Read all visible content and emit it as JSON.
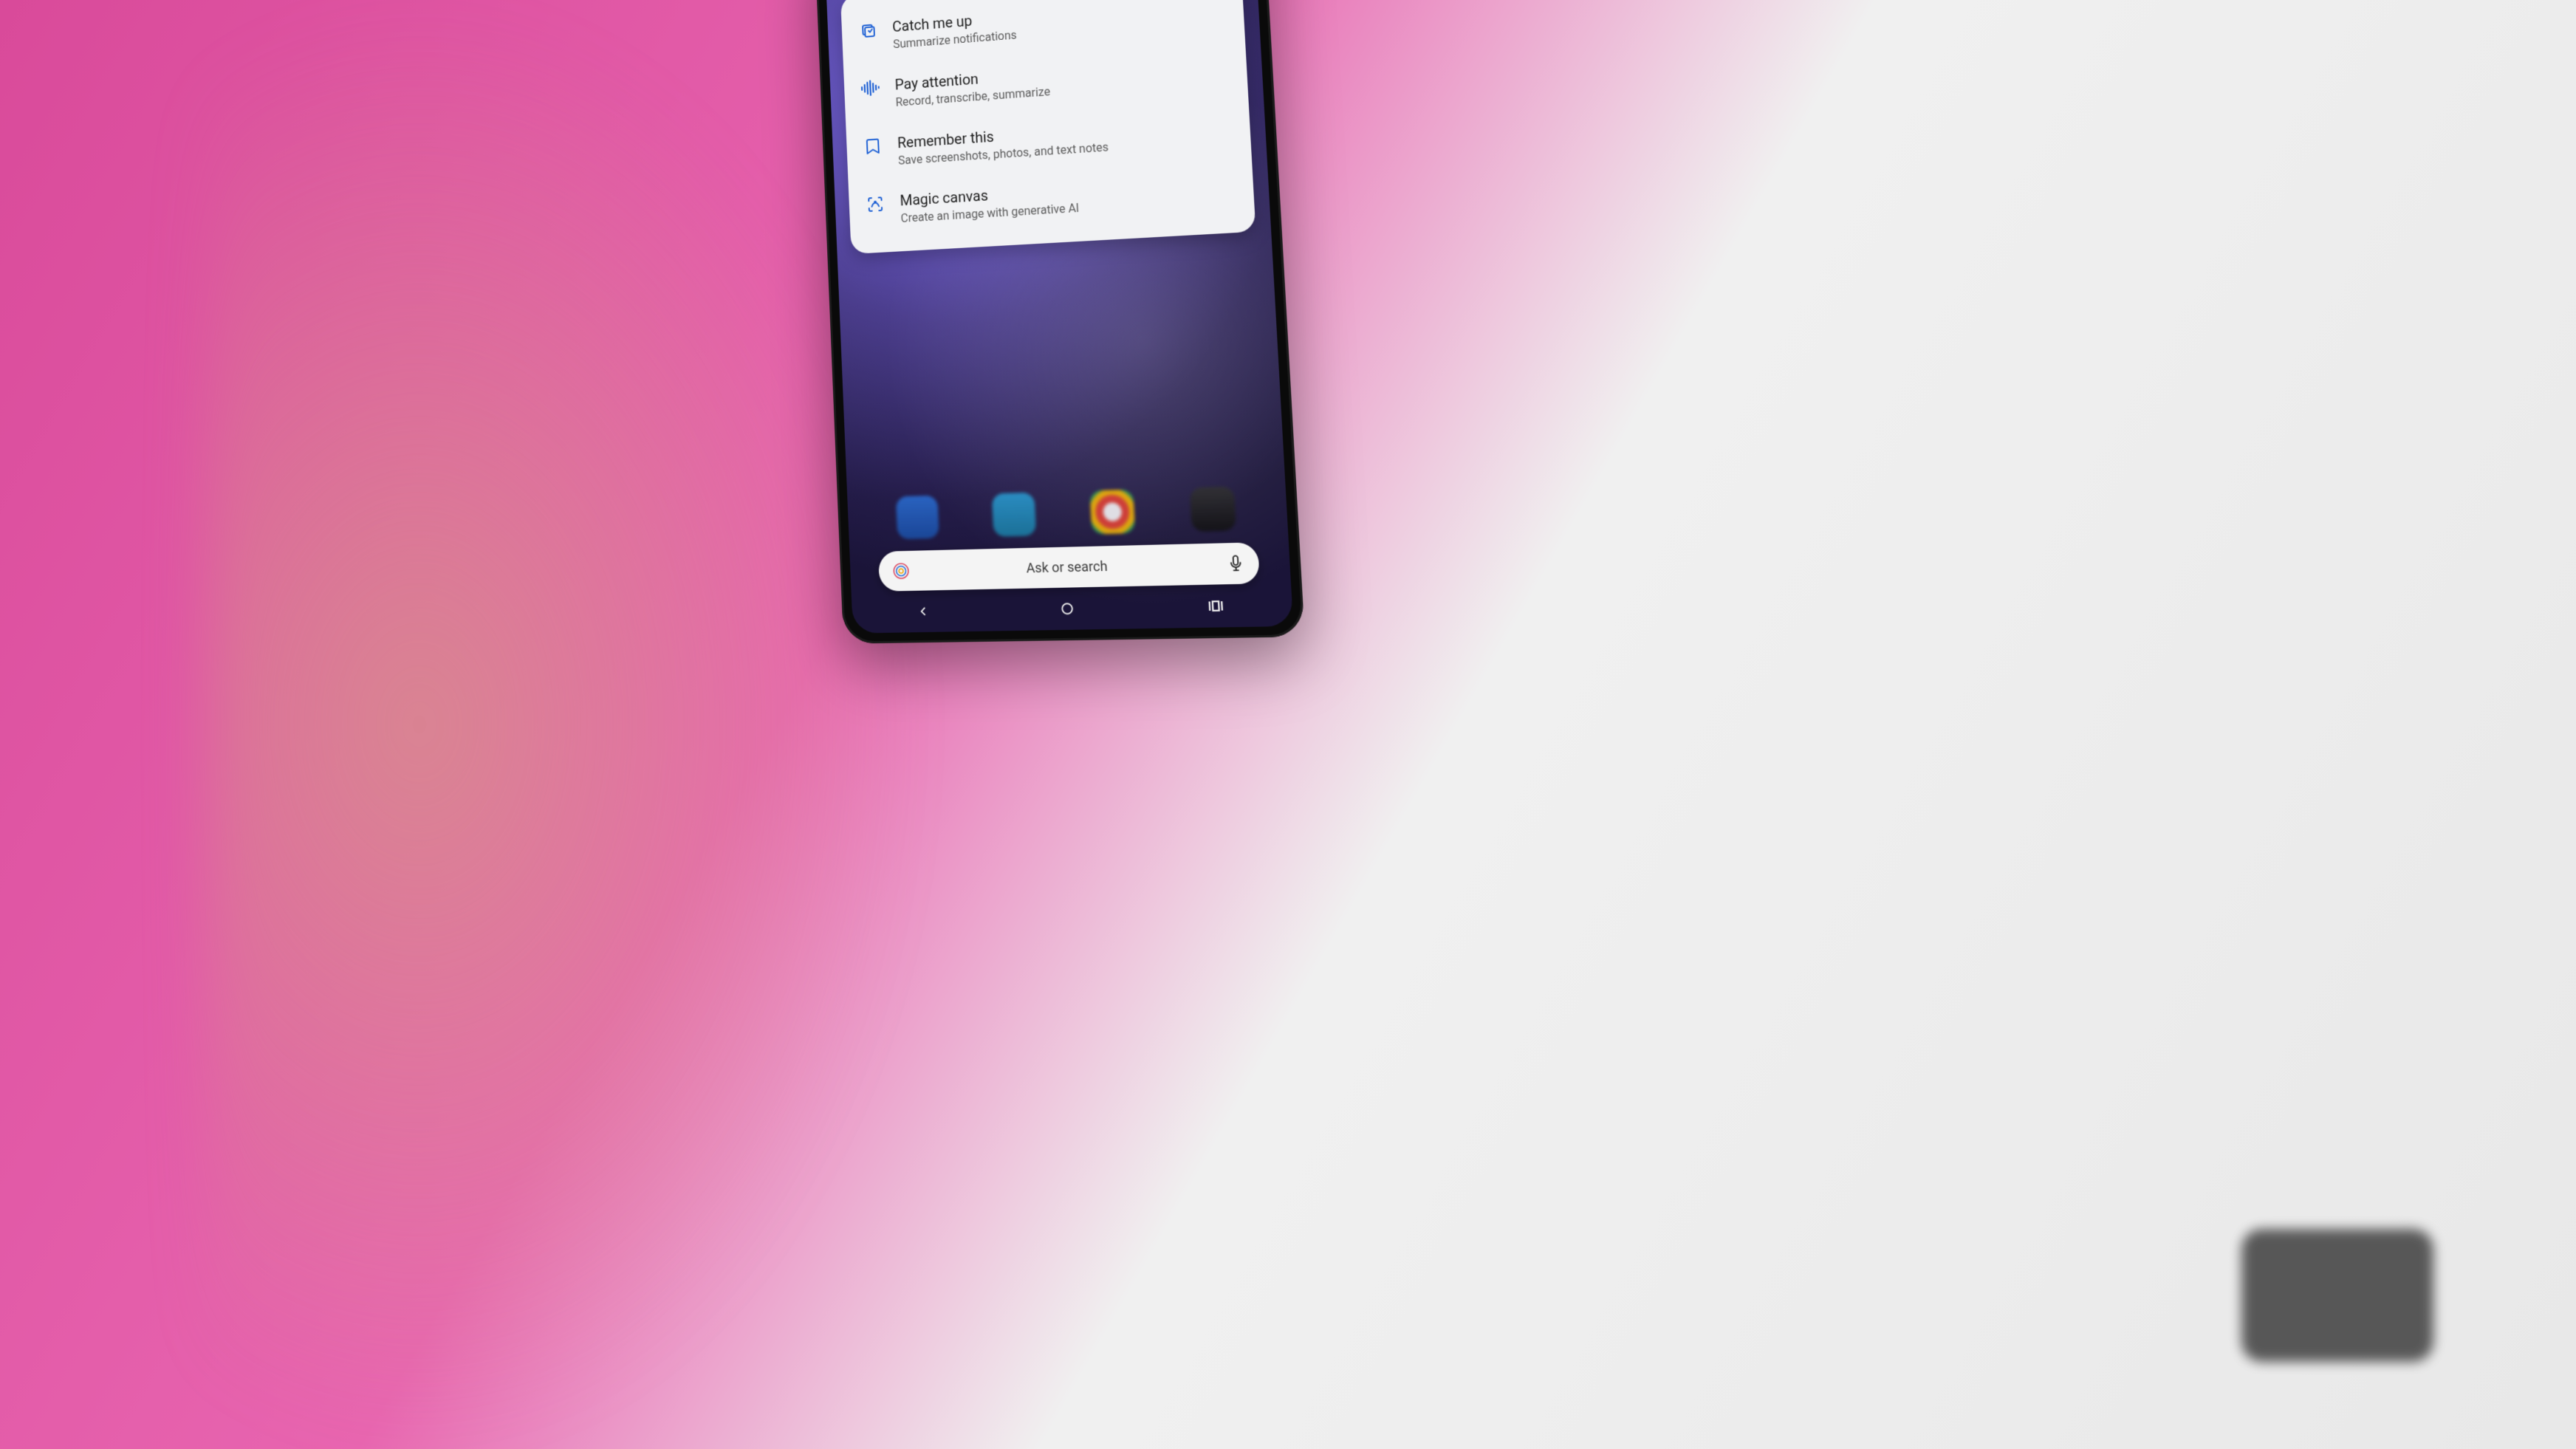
{
  "card": {
    "options": [
      {
        "icon": "catchup-icon",
        "title": "Catch me up",
        "subtitle": "Summarize notifications"
      },
      {
        "icon": "attention-icon",
        "title": "Pay attention",
        "subtitle": "Record, transcribe, summarize"
      },
      {
        "icon": "remember-icon",
        "title": "Remember this",
        "subtitle": "Save screenshots, photos, and text notes"
      },
      {
        "icon": "canvas-icon",
        "title": "Magic canvas",
        "subtitle": "Create an image with generative AI"
      }
    ]
  },
  "ask_bar": {
    "placeholder": "Ask or search"
  },
  "colors": {
    "icon_primary": "#1c5fd4",
    "card_bg": "#f1f2f4"
  }
}
